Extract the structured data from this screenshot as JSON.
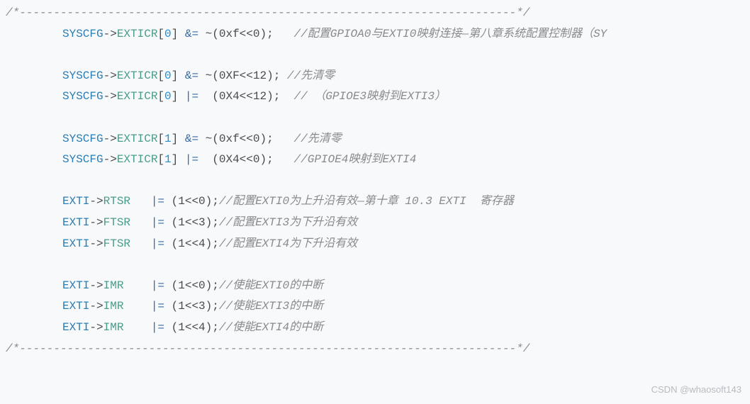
{
  "code": {
    "comment_top": "/*-------------------------------------------------------------------------*/",
    "comment_bottom": "/*-------------------------------------------------------------------------*/",
    "struct1": "SYSCFG",
    "member1": "EXTICR",
    "struct2": "EXTI",
    "lines": {
      "l1": {
        "idx": "0",
        "op": "&=",
        "val": "~(0xf<<0)",
        "c": "//配置GPIOA0与EXTI0映射连接—第八章系统配置控制器（SY"
      },
      "l2": {
        "idx": "0",
        "op": "&=",
        "val": "~(0XF<<12)",
        "c": "//先清零"
      },
      "l3": {
        "idx": "0",
        "op": "|=",
        "val": " (0X4<<12)",
        "c": "// （GPIOE3映射到EXTI3）"
      },
      "l4": {
        "idx": "1",
        "op": "&=",
        "val": "~(0xf<<0)",
        "c": "//先清零"
      },
      "l5": {
        "idx": "1",
        "op": "|=",
        "val": " (0X4<<0)",
        "c": "//GPIOE4映射到EXTI4"
      },
      "l6": {
        "mem": "RTSR",
        "op": "|=",
        "val": "(1<<0)",
        "c": "//配置EXTI0为上升沿有效—第十章 10.3 EXTI  寄存器"
      },
      "l7": {
        "mem": "FTSR",
        "op": "|=",
        "val": "(1<<3)",
        "c": "//配置EXTI3为下升沿有效"
      },
      "l8": {
        "mem": "FTSR",
        "op": "|=",
        "val": "(1<<4)",
        "c": "//配置EXTI4为下升沿有效"
      },
      "l9": {
        "mem": "IMR",
        "op": "|=",
        "val": "(1<<0)",
        "c": "//使能EXTI0的中断"
      },
      "l10": {
        "mem": "IMR",
        "op": "|=",
        "val": "(1<<3)",
        "c": "//使能EXTI3的中断"
      },
      "l11": {
        "mem": "IMR",
        "op": "|=",
        "val": "(1<<4)",
        "c": "//使能EXTI4的中断"
      }
    }
  },
  "watermark": "CSDN @whaosoft143"
}
